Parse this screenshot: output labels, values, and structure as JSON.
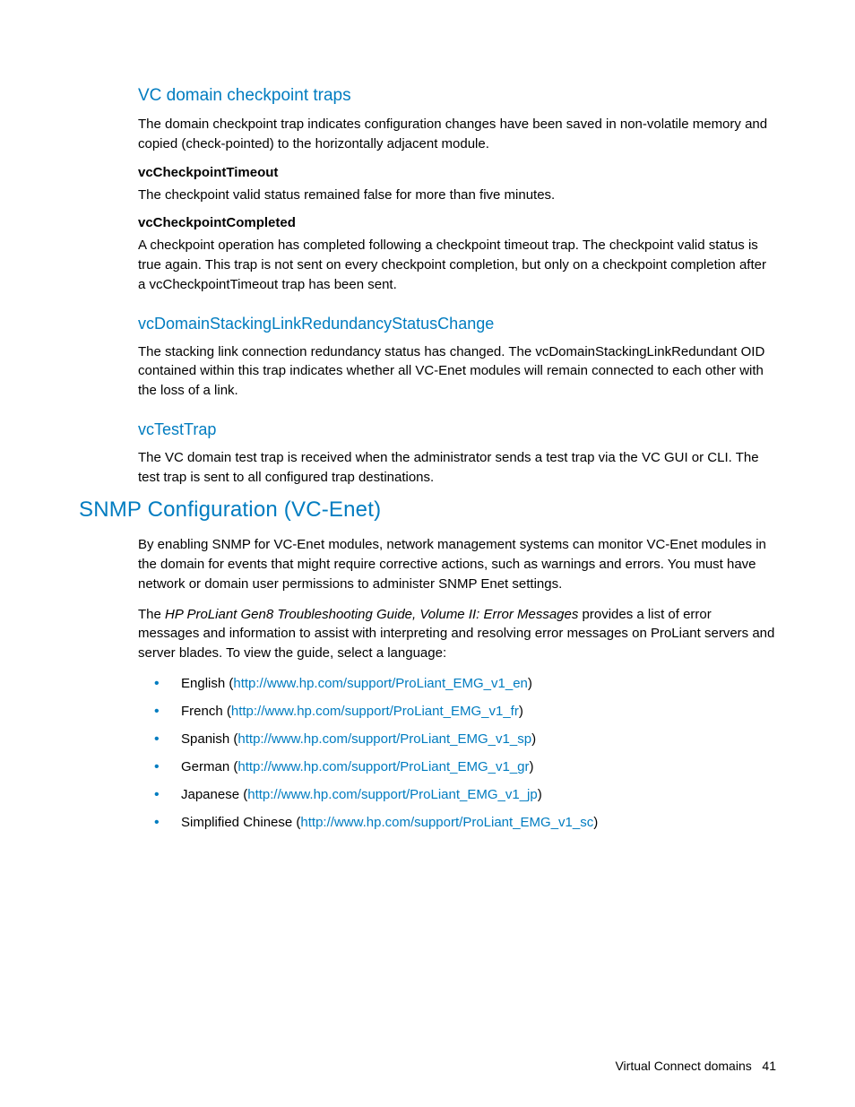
{
  "sections": {
    "vcDomainCheckpoint": {
      "heading": "VC domain checkpoint traps",
      "intro": "The domain checkpoint trap indicates configuration changes have been saved in non-volatile memory and copied (check-pointed) to the horizontally adjacent module.",
      "traps": [
        {
          "name": "vcCheckpointTimeout",
          "desc": "The checkpoint valid status remained false for more than five minutes."
        },
        {
          "name": "vcCheckpointCompleted",
          "desc": "A checkpoint operation has completed following a checkpoint timeout trap. The checkpoint valid status is true again. This trap is not sent on every checkpoint completion, but only on a checkpoint completion after a vcCheckpointTimeout trap has been sent."
        }
      ]
    },
    "stackingLink": {
      "heading": "vcDomainStackingLinkRedundancyStatusChange",
      "desc": "The stacking link connection redundancy status has changed. The vcDomainStackingLinkRedundant OID contained within this trap indicates whether all VC-Enet modules will remain connected to each other with the loss of a link."
    },
    "testTrap": {
      "heading": "vcTestTrap",
      "desc": "The VC domain test trap is received when the administrator sends a test trap via the VC GUI or CLI. The test trap is sent to all configured trap destinations."
    },
    "snmp": {
      "heading": "SNMP Configuration (VC-Enet)",
      "p1": "By enabling SNMP for VC-Enet modules, network management systems can monitor VC-Enet modules in the domain for events that might require corrective actions, such as warnings and errors. You must have network or domain user permissions to administer SNMP Enet settings.",
      "p2_pre": "The ",
      "p2_em": "HP ProLiant Gen8 Troubleshooting Guide, Volume II: Error Messages",
      "p2_post": " provides a list of error messages and information to assist with interpreting and resolving error messages on ProLiant servers and server blades. To view the guide, select a language:",
      "links": [
        {
          "label": "English",
          "url": "http://www.hp.com/support/ProLiant_EMG_v1_en"
        },
        {
          "label": "French",
          "url": "http://www.hp.com/support/ProLiant_EMG_v1_fr"
        },
        {
          "label": "Spanish",
          "url": "http://www.hp.com/support/ProLiant_EMG_v1_sp"
        },
        {
          "label": "German",
          "url": "http://www.hp.com/support/ProLiant_EMG_v1_gr"
        },
        {
          "label": "Japanese",
          "url": "http://www.hp.com/support/ProLiant_EMG_v1_jp"
        },
        {
          "label": "Simplified Chinese",
          "url": "http://www.hp.com/support/ProLiant_EMG_v1_sc"
        }
      ]
    }
  },
  "footer": {
    "section": "Virtual Connect domains",
    "page": "41"
  }
}
